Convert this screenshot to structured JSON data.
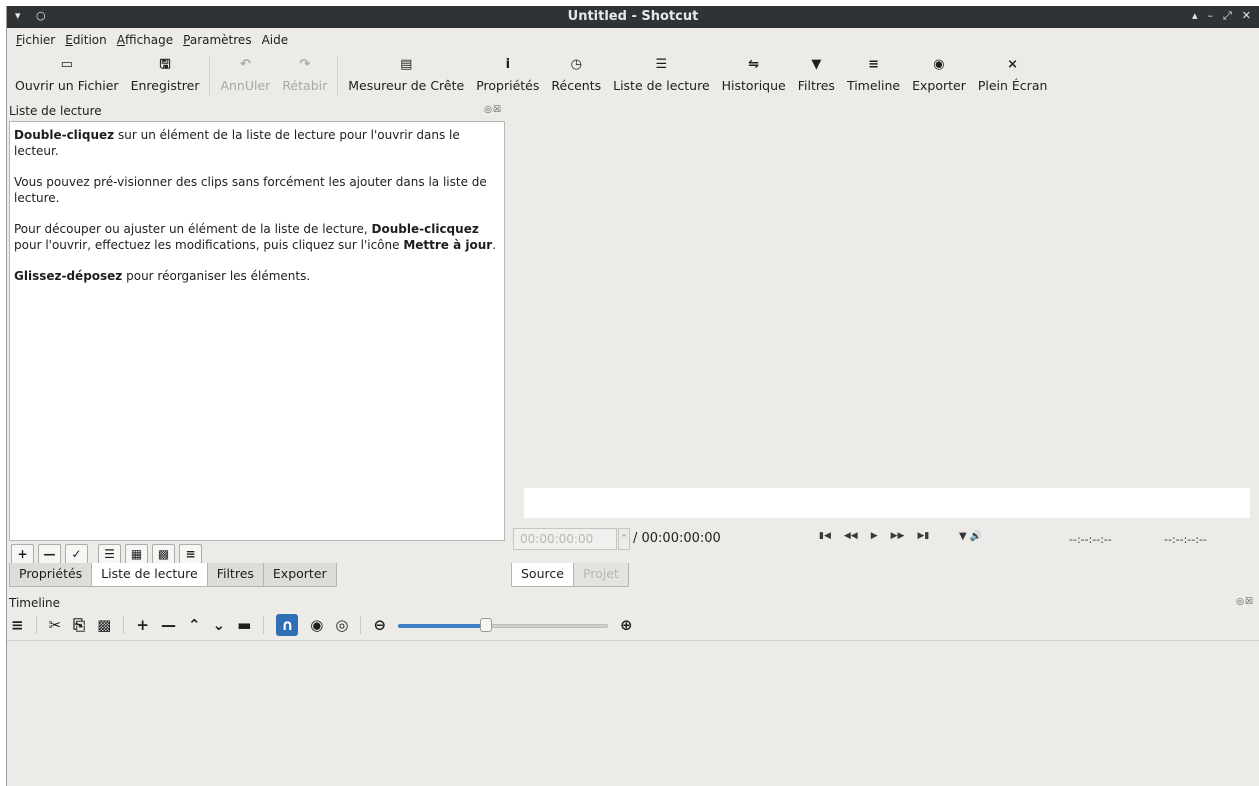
{
  "window": {
    "title": "Untitled - Shotcut"
  },
  "titlebar": {
    "left_icons": "▾ ○",
    "right_icons": [
      "▴",
      "–",
      "⤢",
      "✕"
    ]
  },
  "menubar": {
    "items": [
      {
        "first": "F",
        "rest": "ichier"
      },
      {
        "first": "E",
        "rest": "dition"
      },
      {
        "first": "A",
        "rest": "ffichage"
      },
      {
        "first": "P",
        "rest": "aramètres"
      },
      {
        "first": "A",
        "mid_pre": "",
        "rest": "ide",
        "label_full": "Aide"
      }
    ]
  },
  "toolbar": {
    "open": {
      "label": "Ouvrir un Fichier",
      "icon": "folder-icon"
    },
    "save": {
      "label": "Enregistrer",
      "icon": "save-icon"
    },
    "undo": {
      "label": "AnnUler",
      "icon": "undo-icon"
    },
    "redo": {
      "label": "Rétabir",
      "icon": "redo-icon"
    },
    "peak": {
      "label": "Mesureur de Crête",
      "icon": "meter-icon"
    },
    "props": {
      "label": "Propriétés",
      "icon": "info-icon"
    },
    "recent": {
      "label": "Récents",
      "icon": "clock-icon"
    },
    "playlist": {
      "label": "Liste de lecture",
      "icon": "list-icon"
    },
    "history": {
      "label": "Historique",
      "icon": "history-icon"
    },
    "filters": {
      "label": "Filtres",
      "icon": "filter-icon"
    },
    "timeline": {
      "label": "Timeline",
      "icon": "timeline-icon"
    },
    "export": {
      "label": "Exporter",
      "icon": "export-icon"
    },
    "fullscreen": {
      "label": "Plein Écran",
      "icon": "fullscreen-icon"
    }
  },
  "playlist": {
    "title": "Liste de lecture",
    "dock_buttons": "◎☒",
    "help": {
      "p1_bold": "Double-cliquez",
      "p1_rest": " sur un élément de la liste de lecture pour l'ouvrir dans le lecteur.",
      "p2": "Vous pouvez pré-visionner des clips sans forcément les ajouter dans la liste de lecture.",
      "p3_a": "Pour découper ou ajuster un élément de la liste de lecture, ",
      "p3_b": "Double-clicquez",
      "p3_c": " pour l'ouvrir, effectuez les modifications, puis cliquez sur l'icône ",
      "p3_d": "Mettre à jour",
      "p3_e": ".",
      "p4_bold": "Glissez-déposez",
      "p4_rest": " pour réorganiser les éléments."
    }
  },
  "left_tabs": [
    "Propriétés",
    "Liste de lecture",
    "Filtres",
    "Exporter"
  ],
  "player": {
    "timecode": "00:00:00:00",
    "duration": "/ 00:00:00:00",
    "in_point": "--:--:--:--",
    "out_point": "--:--:--:--",
    "tabs": [
      "Source",
      "Projet"
    ]
  },
  "timeline": {
    "title": "Timeline",
    "dock_buttons": "◎☒",
    "zoom_level": 0.42
  }
}
